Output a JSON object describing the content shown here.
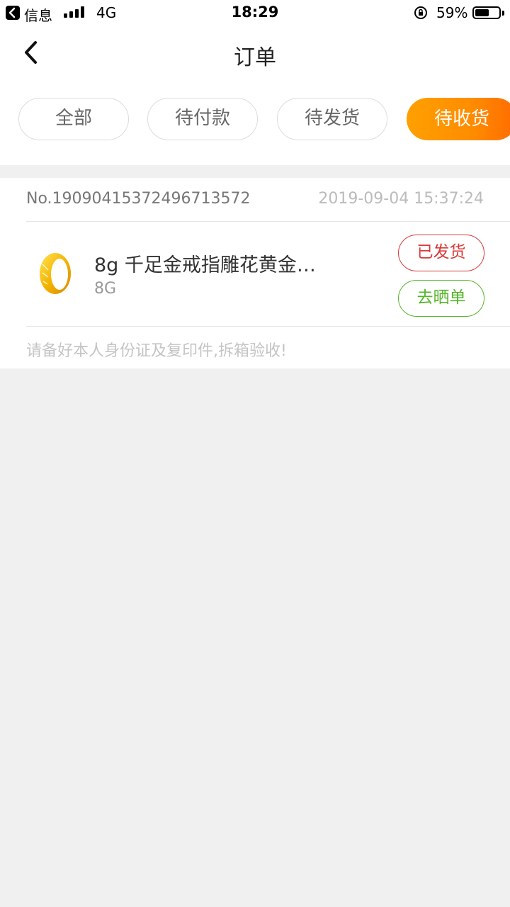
{
  "status_bar": {
    "carrier": "信息",
    "network": "4G",
    "time": "18:29",
    "battery_percent": "59%",
    "battery_level": 0.59
  },
  "nav": {
    "title": "订单",
    "back_icon": "chevron-left-icon"
  },
  "tabs": [
    {
      "label": "全部",
      "active": false
    },
    {
      "label": "待付款",
      "active": false
    },
    {
      "label": "待发货",
      "active": false
    },
    {
      "label": "待收货",
      "active": true
    }
  ],
  "order": {
    "number": "No.19090415372496713572",
    "date": "2019-09-04 15:37:24",
    "product": {
      "name": "8g 千足金戒指雕花黄金…",
      "spec": "8G",
      "image_icon": "gold-ring-image"
    },
    "status_label": "已发货",
    "review_label": "去晒单",
    "note": "请备好本人身份证及复印件,拆箱验收!"
  },
  "colors": {
    "accent_orange": "#ff8c00",
    "shipped_red": "#d83a3a",
    "review_green": "#55b52a",
    "background": "#f0f0f0"
  }
}
